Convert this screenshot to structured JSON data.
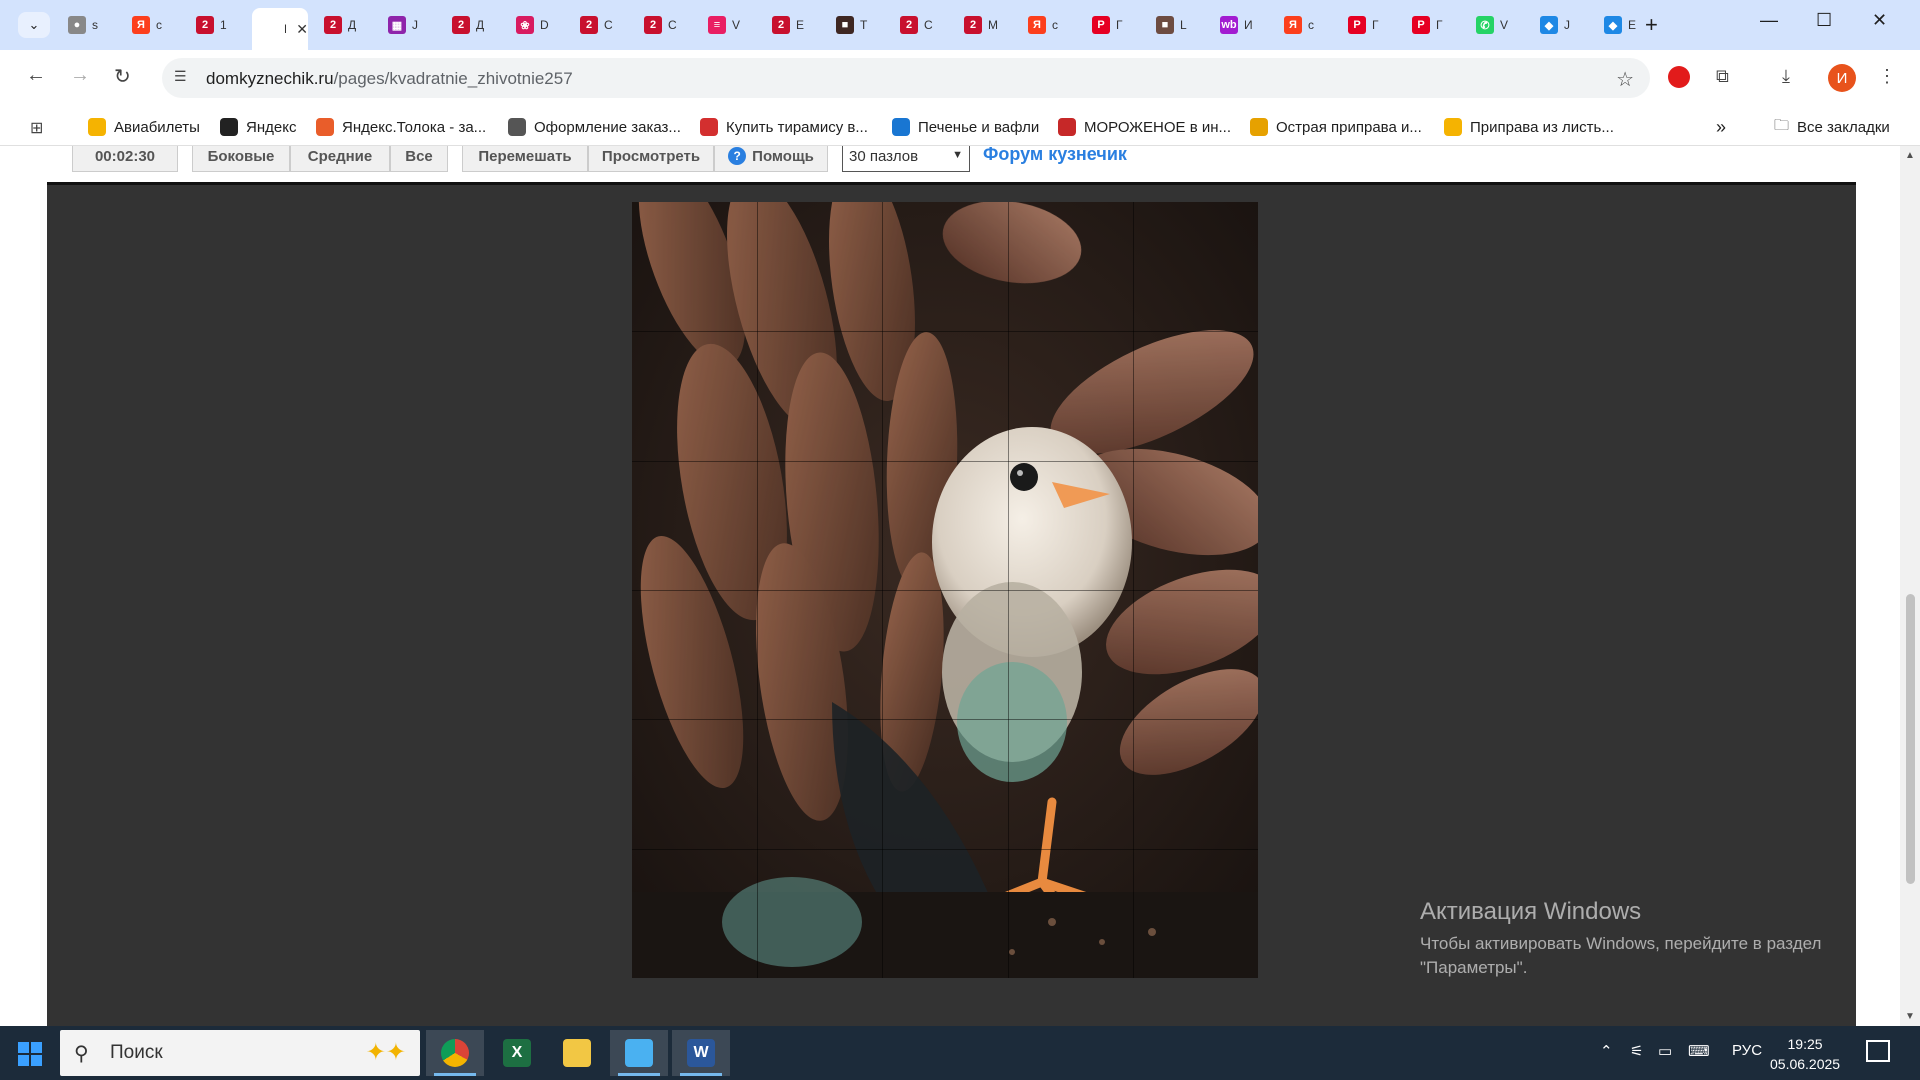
{
  "browser": {
    "tabs": [
      {
        "title": "s",
        "favicon_color": "#888888",
        "favicon_glyph": "●"
      },
      {
        "title": "с",
        "favicon_color": "#fc3f1d",
        "favicon_glyph": "Я"
      },
      {
        "title": "1",
        "favicon_color": "#c8102e",
        "favicon_glyph": "2"
      },
      {
        "title": "К",
        "favicon_color": "#ffffff",
        "favicon_glyph": "",
        "active": true
      },
      {
        "title": "Д",
        "favicon_color": "#c8102e",
        "favicon_glyph": "2"
      },
      {
        "title": "J",
        "favicon_color": "#8e24aa",
        "favicon_glyph": "▦"
      },
      {
        "title": "Д",
        "favicon_color": "#c8102e",
        "favicon_glyph": "2"
      },
      {
        "title": "D",
        "favicon_color": "#d81b60",
        "favicon_glyph": "❀"
      },
      {
        "title": "С",
        "favicon_color": "#c8102e",
        "favicon_glyph": "2"
      },
      {
        "title": "С",
        "favicon_color": "#c8102e",
        "favicon_glyph": "2"
      },
      {
        "title": "V",
        "favicon_color": "#e91e63",
        "favicon_glyph": "≡"
      },
      {
        "title": "E",
        "favicon_color": "#c8102e",
        "favicon_glyph": "2"
      },
      {
        "title": "T",
        "favicon_color": "#3e2723",
        "favicon_glyph": "■"
      },
      {
        "title": "С",
        "favicon_color": "#c8102e",
        "favicon_glyph": "2"
      },
      {
        "title": "М",
        "favicon_color": "#c8102e",
        "favicon_glyph": "2"
      },
      {
        "title": "с",
        "favicon_color": "#fc3f1d",
        "favicon_glyph": "Я"
      },
      {
        "title": "Г",
        "favicon_color": "#e60023",
        "favicon_glyph": "P"
      },
      {
        "title": "L",
        "favicon_color": "#6d4c41",
        "favicon_glyph": "■"
      },
      {
        "title": "И",
        "favicon_color": "#a21cd1",
        "favicon_glyph": "wb"
      },
      {
        "title": "с",
        "favicon_color": "#fc3f1d",
        "favicon_glyph": "Я"
      },
      {
        "title": "Г",
        "favicon_color": "#e60023",
        "favicon_glyph": "P"
      },
      {
        "title": "Г",
        "favicon_color": "#e60023",
        "favicon_glyph": "P"
      },
      {
        "title": "V",
        "favicon_color": "#25d366",
        "favicon_glyph": "✆"
      },
      {
        "title": "J",
        "favicon_color": "#1e88e5",
        "favicon_glyph": "◆"
      },
      {
        "title": "E",
        "favicon_color": "#1e88e5",
        "favicon_glyph": "◆"
      }
    ],
    "new_tab": "+",
    "url_domain": "domkyznechik.ru",
    "url_path": "/pages/kvadratnie_zhivotnie257",
    "profile_initial": "И"
  },
  "bookmarks": [
    {
      "label": "Авиабилеты",
      "color": "#f5b301"
    },
    {
      "label": "Яндекс",
      "color": "#222222"
    },
    {
      "label": "Яндекс.Толока - за...",
      "color": "#e95d2a"
    },
    {
      "label": "Оформление заказ...",
      "color": "#555555"
    },
    {
      "label": "Купить тирамису в...",
      "color": "#d32f2f"
    },
    {
      "label": "Печенье и вафли",
      "color": "#1976d2"
    },
    {
      "label": "МОРОЖЕНОЕ в ин...",
      "color": "#c62828"
    },
    {
      "label": "Острая приправа и...",
      "color": "#e6a100"
    },
    {
      "label": "Приправа из листь...",
      "color": "#f5b301"
    }
  ],
  "bookmarks_overflow": "»",
  "all_bookmarks": "Все закладки",
  "puzzle": {
    "timer": "00:02:30",
    "buttons": [
      "Боковые",
      "Средние",
      "Все",
      "Перемешать",
      "Просмотреть",
      "Помощь"
    ],
    "help_icon": "?",
    "piece_count": "30 пазлов",
    "forum_link": "Форум кузнечик",
    "cols": 5,
    "rows": 6
  },
  "activation": {
    "title": "Активация Windows",
    "line1": "Чтобы активировать Windows, перейдите в раздел",
    "line2": "\"Параметры\"."
  },
  "taskbar": {
    "search_label": "Поиск",
    "apps": [
      {
        "name": "chrome",
        "glyph": "",
        "color": "#ffffff",
        "active": true
      },
      {
        "name": "excel",
        "glyph": "X",
        "color": "#1d6f42",
        "active": false
      },
      {
        "name": "explorer",
        "glyph": "",
        "color": "#f2c744",
        "active": false
      },
      {
        "name": "photos",
        "glyph": "",
        "color": "#4ab1f1",
        "active": true
      },
      {
        "name": "word",
        "glyph": "W",
        "color": "#2b579a",
        "active": true
      }
    ],
    "lang": "РУС",
    "time": "19:25",
    "date": "05.06.2025"
  }
}
